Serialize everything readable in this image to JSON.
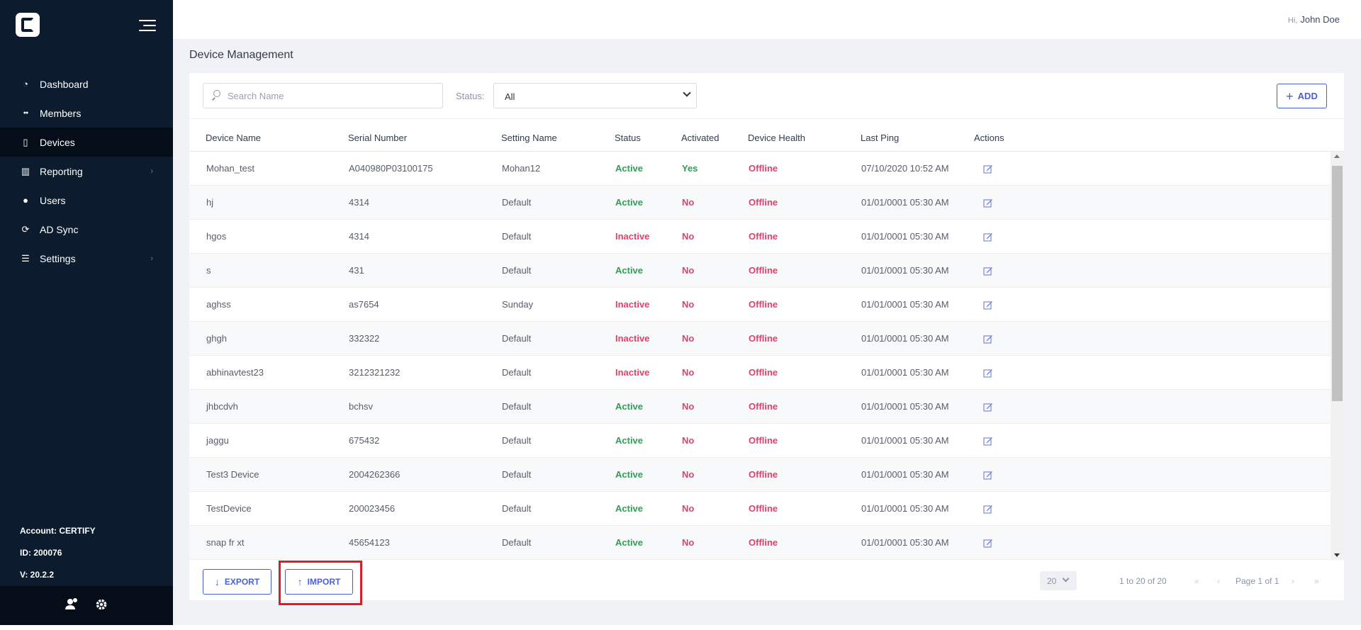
{
  "sidebar": {
    "nav": [
      {
        "label": "Dashboard",
        "icon": "dashboard-icon",
        "active": false,
        "chevron": false
      },
      {
        "label": "Members",
        "icon": "members-icon",
        "active": false,
        "chevron": false
      },
      {
        "label": "Devices",
        "icon": "devices-icon",
        "active": true,
        "chevron": false
      },
      {
        "label": "Reporting",
        "icon": "reporting-icon",
        "active": false,
        "chevron": true
      },
      {
        "label": "Users",
        "icon": "user-icon",
        "active": false,
        "chevron": false
      },
      {
        "label": "AD Sync",
        "icon": "sync-icon",
        "active": false,
        "chevron": false
      },
      {
        "label": "Settings",
        "icon": "settings-sliders-icon",
        "active": false,
        "chevron": true
      }
    ],
    "account": "Account: CERTIFY",
    "id": "ID: 200076",
    "version": "V: 20.2.2"
  },
  "header": {
    "greeting_hi": "Hi,",
    "user_name": "John Doe"
  },
  "page": {
    "title": "Device Management"
  },
  "toolbar": {
    "search_placeholder": "Search Name",
    "status_label": "Status:",
    "status_value": "All",
    "add_label": "ADD"
  },
  "table": {
    "columns": [
      "Device Name",
      "Serial Number",
      "Setting Name",
      "Status",
      "Activated",
      "Device Health",
      "Last Ping",
      "Actions"
    ],
    "rows": [
      [
        "Mohan_test",
        "A040980P03100175",
        "Mohan12",
        "Active",
        "Yes",
        "Offline",
        "07/10/2020 10:52 AM"
      ],
      [
        "hj",
        "4314",
        "Default",
        "Active",
        "No",
        "Offline",
        "01/01/0001 05:30 AM"
      ],
      [
        "hgos",
        "4314",
        "Default",
        "Inactive",
        "No",
        "Offline",
        "01/01/0001 05:30 AM"
      ],
      [
        "s",
        "431",
        "Default",
        "Active",
        "No",
        "Offline",
        "01/01/0001 05:30 AM"
      ],
      [
        "aghss",
        "as7654",
        "Sunday",
        "Inactive",
        "No",
        "Offline",
        "01/01/0001 05:30 AM"
      ],
      [
        "ghgh",
        "332322",
        "Default",
        "Inactive",
        "No",
        "Offline",
        "01/01/0001 05:30 AM"
      ],
      [
        "abhinavtest23",
        "3212321232",
        "Default",
        "Inactive",
        "No",
        "Offline",
        "01/01/0001 05:30 AM"
      ],
      [
        "jhbcdvh",
        "bchsv",
        "Default",
        "Active",
        "No",
        "Offline",
        "01/01/0001 05:30 AM"
      ],
      [
        "jaggu",
        "675432",
        "Default",
        "Active",
        "No",
        "Offline",
        "01/01/0001 05:30 AM"
      ],
      [
        "Test3 Device",
        "2004262366",
        "Default",
        "Active",
        "No",
        "Offline",
        "01/01/0001 05:30 AM"
      ],
      [
        "TestDevice",
        "200023456",
        "Default",
        "Active",
        "No",
        "Offline",
        "01/01/0001 05:30 AM"
      ],
      [
        "snap fr xt",
        "45654123",
        "Default",
        "Active",
        "No",
        "Offline",
        "01/01/0001 05:30 AM"
      ]
    ]
  },
  "footer": {
    "export_label": "EXPORT",
    "import_label": "IMPORT",
    "page_size": "20",
    "range": "1 to 20 of 20",
    "page_label": "Page 1 of 1"
  },
  "colors": {
    "sidebar_bg": "#0c1b2e",
    "accent": "#4a5fd6",
    "active_green": "#2e9e55",
    "inactive_red": "#e43f67",
    "highlight": "#e01b24"
  }
}
